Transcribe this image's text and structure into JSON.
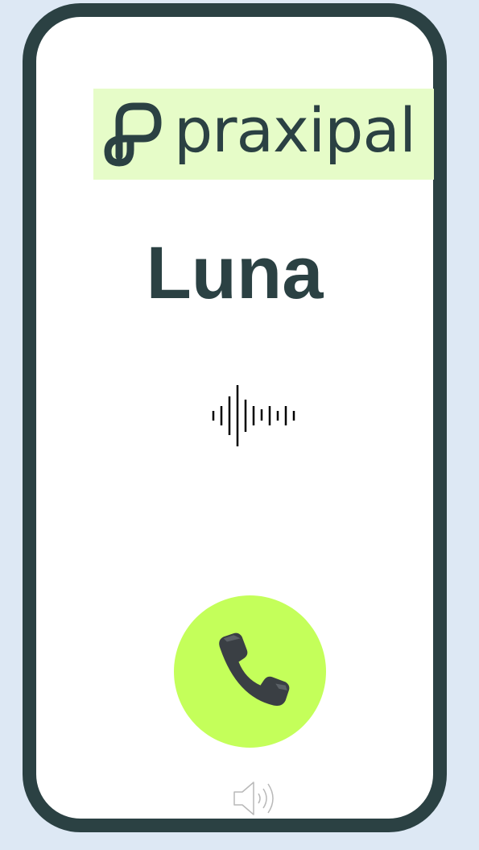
{
  "brand": {
    "name": "praxipal",
    "logo_background": "#e6fcc8",
    "logo_color": "#2b4143"
  },
  "call": {
    "caller_name": "Luna",
    "status_icon": "audio-waveform-icon",
    "answer_icon": "phone-handset-icon",
    "answer_color": "#c4ff5a",
    "speaker_icon": "speaker-volume-icon"
  },
  "colors": {
    "background": "#dde8f4",
    "frame": "#2b4143",
    "screen": "#ffffff"
  }
}
